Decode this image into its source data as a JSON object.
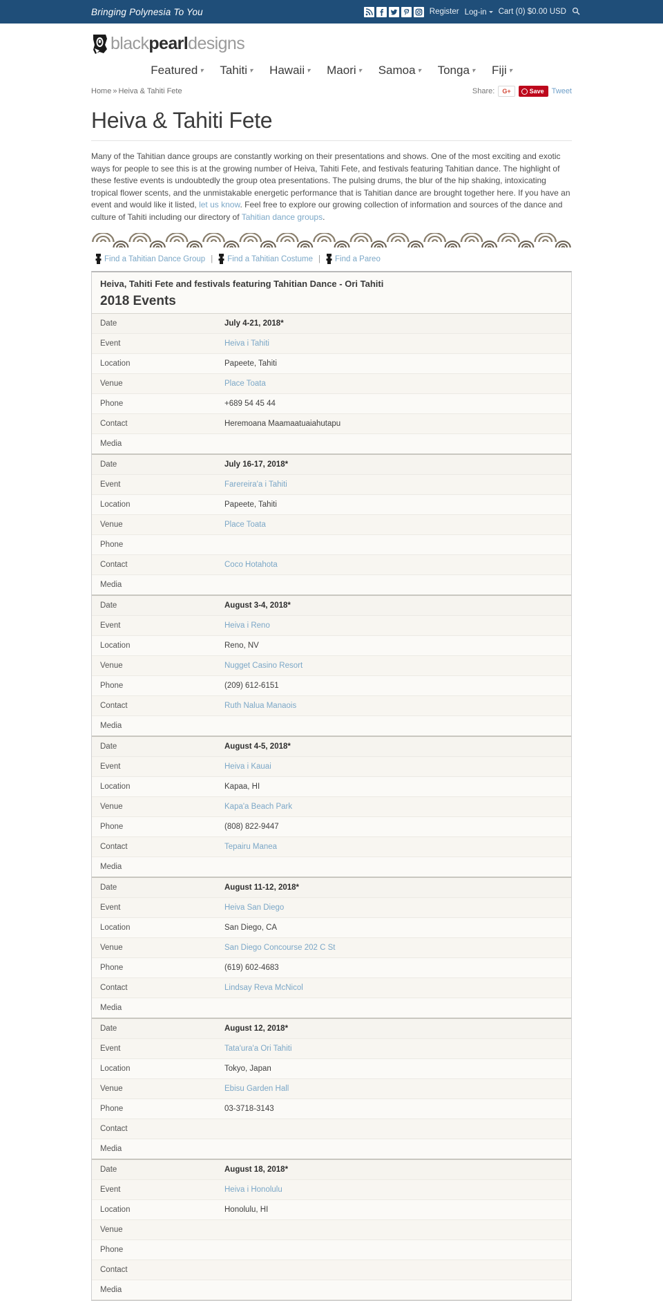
{
  "topbar": {
    "tagline": "Bringing Polynesia To You",
    "social": [
      {
        "name": "rss-icon",
        "glyph": "◔"
      },
      {
        "name": "facebook-icon",
        "glyph": "f"
      },
      {
        "name": "twitter-icon",
        "glyph": "t"
      },
      {
        "name": "pinterest-icon",
        "glyph": "P"
      },
      {
        "name": "instagram-icon",
        "glyph": "▣"
      }
    ],
    "register": "Register",
    "login": "Log-in",
    "cart": "Cart (0) $0.00 USD",
    "search_icon": "search-icon"
  },
  "brand": {
    "part1": "black",
    "part2": "pearl",
    "part3": "designs"
  },
  "nav": [
    {
      "label": "Featured"
    },
    {
      "label": "Tahiti"
    },
    {
      "label": "Hawaii"
    },
    {
      "label": "Maori"
    },
    {
      "label": "Samoa"
    },
    {
      "label": "Tonga"
    },
    {
      "label": "Fiji"
    }
  ],
  "breadcrumb": {
    "home": "Home",
    "separator": "»",
    "current": "Heiva & Tahiti Fete"
  },
  "share": {
    "label": "Share:",
    "gplus": "G+",
    "pinterest": "Save",
    "twitter": "Tweet"
  },
  "page": {
    "title": "Heiva & Tahiti Fete",
    "intro_1": "Many of the Tahitian dance groups are constantly working on their presentations and shows. One of the most exciting and exotic ways for people to see this is at the growing number of Heiva, Tahiti Fete, and festivals featuring Tahitian dance. The highlight of these festive events is undoubtedly the group otea presentations. The pulsing drums, the blur of the hip shaking, intoxicating tropical flower scents, and the unmistakable energetic performance that is Tahitian dance are brought together here. If you have an event and would like it listed, ",
    "intro_link_1": "let us know",
    "intro_2": ". Feel free to explore our growing collection of information and sources of the dance and culture of Tahiti including our directory of ",
    "intro_link_2": "Tahitian dance groups",
    "intro_3": "."
  },
  "find_links": [
    {
      "label": "Find a Tahitian Dance Group"
    },
    {
      "label": "Find a Tahitian Costume"
    },
    {
      "label": "Find a Pareo"
    }
  ],
  "panel": {
    "title": "Heiva, Tahiti Fete and festivals featuring Tahitian Dance - Ori Tahiti",
    "year": "2018 Events"
  },
  "labels": {
    "date": "Date",
    "event": "Event",
    "location": "Location",
    "venue": "Venue",
    "phone": "Phone",
    "contact": "Contact",
    "media": "Media"
  },
  "events": [
    {
      "date": "July 4-21, 2018*",
      "event": "Heiva i Tahiti",
      "event_link": true,
      "location": "Papeete, Tahiti",
      "venue": "Place Toata",
      "venue_link": true,
      "phone": "+689 54 45 44",
      "contact": "Heremoana Maamaatuaiahutapu",
      "contact_link": false,
      "media": ""
    },
    {
      "date": "July 16-17, 2018*",
      "event": "Farereira'a i Tahiti",
      "event_link": true,
      "location": "Papeete, Tahiti",
      "venue": "Place Toata",
      "venue_link": true,
      "phone": "",
      "contact": "Coco Hotahota",
      "contact_link": true,
      "media": ""
    },
    {
      "date": "August 3-4, 2018*",
      "event": "Heiva i Reno",
      "event_link": true,
      "location": "Reno, NV",
      "venue": "Nugget Casino Resort",
      "venue_link": true,
      "phone": "(209) 612-6151",
      "contact": "Ruth Nalua Manaois",
      "contact_link": true,
      "media": ""
    },
    {
      "date": "August 4-5, 2018*",
      "event": "Heiva i Kauai",
      "event_link": true,
      "location": "Kapaa, HI",
      "venue": "Kapa'a Beach Park",
      "venue_link": true,
      "phone": "(808) 822-9447",
      "contact": "Tepairu Manea",
      "contact_link": true,
      "media": ""
    },
    {
      "date": "August 11-12, 2018*",
      "event": "Heiva San Diego",
      "event_link": true,
      "location": "San Diego, CA",
      "venue": "San Diego Concourse 202 C St",
      "venue_link": true,
      "phone": "(619) 602-4683",
      "contact": "Lindsay Reva McNicol",
      "contact_link": true,
      "media": ""
    },
    {
      "date": "August 12, 2018*",
      "event": "Tata'ura'a Ori Tahiti",
      "event_link": true,
      "location": "Tokyo, Japan",
      "venue": "Ebisu Garden Hall",
      "venue_link": true,
      "phone": "03-3718-3143",
      "contact": "",
      "contact_link": false,
      "media": ""
    },
    {
      "date": "August 18, 2018*",
      "event": "Heiva i Honolulu",
      "event_link": true,
      "location": "Honolulu, HI",
      "venue": "",
      "venue_link": false,
      "phone": "",
      "contact": "",
      "contact_link": false,
      "media": ""
    }
  ],
  "colors": {
    "topbar_bg": "#1f4e79",
    "link": "#7ba7c7",
    "pinterest_red": "#bd081c",
    "panel_bg": "#fbfaf7"
  }
}
